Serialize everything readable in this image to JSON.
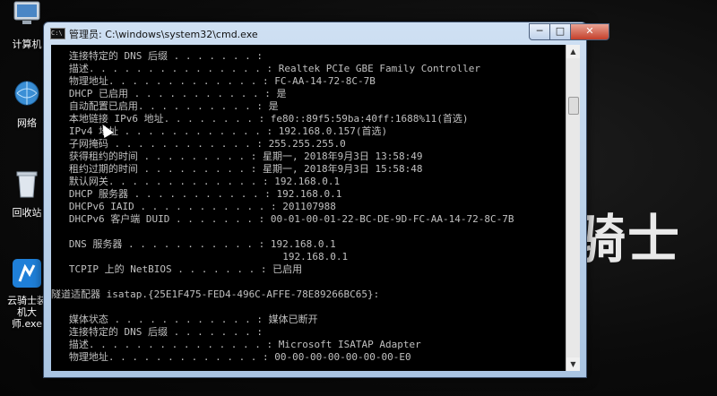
{
  "desktop": {
    "icons": [
      {
        "label": "计算机",
        "icon": "computer-icon"
      },
      {
        "label": "网络",
        "icon": "network-icon"
      },
      {
        "label": "回收站",
        "icon": "recycle-bin-icon"
      },
      {
        "label": "云骑士装机大师.exe",
        "icon": "yunqishi-app-icon"
      }
    ],
    "background_text": "骑士"
  },
  "window": {
    "title": "管理员: C:\\windows\\system32\\cmd.exe",
    "controls": {
      "minimize": "─",
      "maximize": "□",
      "close": "✕"
    },
    "lines": [
      "   连接特定的 DNS 后缀 . . . . . . . :",
      "   描述. . . . . . . . . . . . . . . : Realtek PCIe GBE Family Controller",
      "   物理地址. . . . . . . . . . . . . : FC-AA-14-72-8C-7B",
      "   DHCP 已启用 . . . . . . . . . . . : 是",
      "   自动配置已启用. . . . . . . . . . : 是",
      "   本地链接 IPv6 地址. . . . . . . . : fe80::89f5:59ba:40ff:1688%11(首选)",
      "   IPv4 地址 . . . . . . . . . . . . : 192.168.0.157(首选)",
      "   子网掩码 . . . . . . . . . . . . : 255.255.255.0",
      "   获得租约的时间 . . . . . . . . . : 星期一, 2018年9月3日 13:58:49",
      "   租约过期的时间 . . . . . . . . . : 星期一, 2018年9月3日 15:58:48",
      "   默认网关. . . . . . . . . . . . . : 192.168.0.1",
      "   DHCP 服务器 . . . . . . . . . . . : 192.168.0.1",
      "   DHCPv6 IAID . . . . . . . . . . . : 201107988",
      "   DHCPv6 客户端 DUID . . . . . . . : 00-01-00-01-22-BC-DE-9D-FC-AA-14-72-8C-7B",
      "",
      "   DNS 服务器 . . . . . . . . . . . : 192.168.0.1",
      "                                       192.168.0.1",
      "   TCPIP 上的 NetBIOS . . . . . . . : 已启用",
      "",
      "隧道适配器 isatap.{25E1F475-FED4-496C-AFFE-78E89266BC65}:",
      "",
      "   媒体状态 . . . . . . . . . . . . : 媒体已断开",
      "   连接特定的 DNS 后缀 . . . . . . . :",
      "   描述. . . . . . . . . . . . . . . : Microsoft ISATAP Adapter",
      "   物理地址. . . . . . . . . . . . . : 00-00-00-00-00-00-00-E0"
    ]
  },
  "colors": {
    "console_bg": "#000000",
    "console_fg": "#c0c0c0",
    "close_button": "#c4402b"
  }
}
